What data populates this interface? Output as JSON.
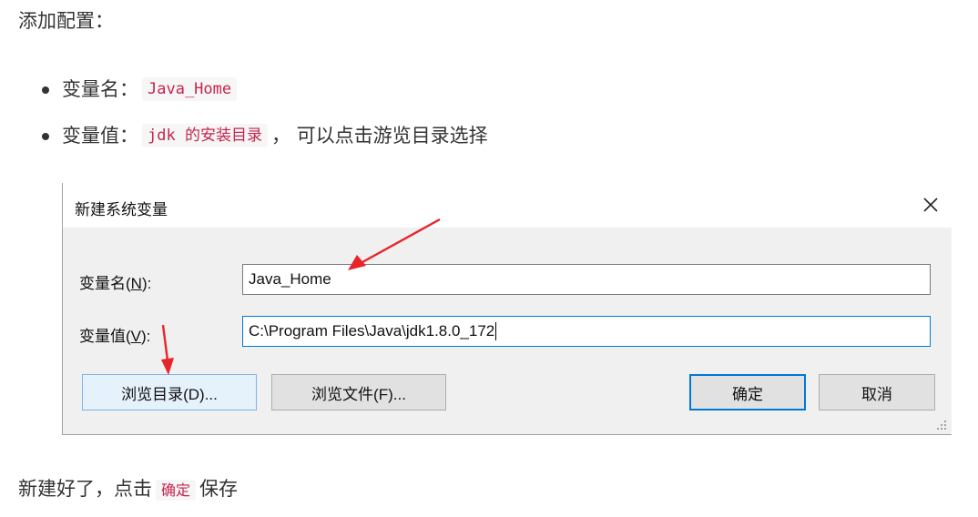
{
  "article": {
    "intro": "添加配置：",
    "bullets": [
      {
        "label": "变量名：",
        "code": "Java_Home",
        "suffix": ""
      },
      {
        "label": "变量值：",
        "code": "jdk 的安装目录",
        "suffix": "， 可以点击游览目录选择"
      }
    ],
    "outro_prefix": "新建好了，点击",
    "outro_code": "确定",
    "outro_suffix": "保存"
  },
  "dialog": {
    "title": "新建系统变量",
    "close_icon": "close-icon",
    "name_label_prefix": "变量名(",
    "name_label_key": "N",
    "name_label_suffix": "):",
    "name_value": "Java_Home",
    "value_label_prefix": "变量值(",
    "value_label_key": "V",
    "value_label_suffix": "):",
    "value_value": "C:\\Program Files\\Java\\jdk1.8.0_172",
    "buttons": {
      "browse_dir": "浏览目录(D)...",
      "browse_file": "浏览文件(F)...",
      "ok": "确定",
      "cancel": "取消"
    }
  },
  "colors": {
    "code_text": "#c7254e",
    "code_bg": "#f6f6f6",
    "arrow": "#e8232a",
    "focus_blue": "#0078d7"
  }
}
